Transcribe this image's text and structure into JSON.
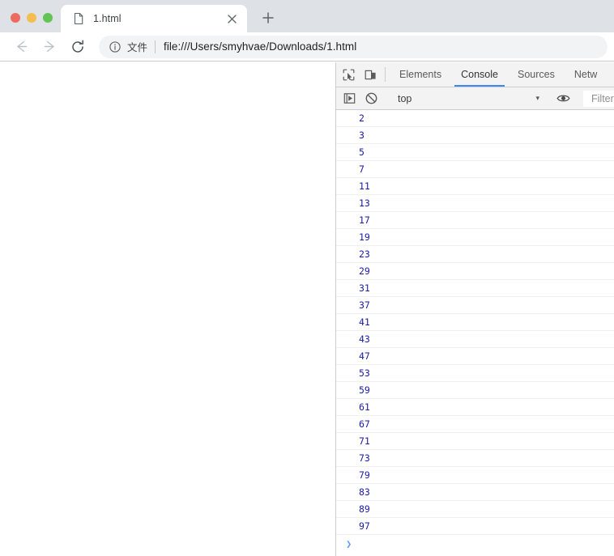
{
  "browser": {
    "window_controls": [
      {
        "name": "close",
        "color": "#ed6a5e"
      },
      {
        "name": "minimize",
        "color": "#f4be4f"
      },
      {
        "name": "maximize",
        "color": "#61c454"
      }
    ],
    "tabs": [
      {
        "title": "1.html",
        "favicon": "document-icon",
        "close_label": "×",
        "active": true
      }
    ],
    "new_tab_label": "+",
    "nav": {
      "back_label": "←",
      "forward_label": "→",
      "reload_label": "⟳"
    },
    "omnibox": {
      "info_icon": "info-circle-icon",
      "scheme_label": "文件",
      "url": "file:///Users/smyhvae/Downloads/1.html"
    }
  },
  "devtools": {
    "toolbar_icons": [
      {
        "name": "inspect-element-icon"
      },
      {
        "name": "device-toolbar-icon"
      }
    ],
    "tabs": [
      {
        "label": "Elements",
        "active": false
      },
      {
        "label": "Console",
        "active": true
      },
      {
        "label": "Sources",
        "active": false
      },
      {
        "label": "Netw",
        "active": false
      }
    ],
    "active_tab_accent": "#4285f4",
    "filterbar": {
      "execute_icon": "execute-snippet-icon",
      "clear_icon": "clear-console-icon",
      "context_value": "top",
      "context_caret": "▾",
      "eye_icon": "live-expression-icon",
      "filter_placeholder": "Filter"
    },
    "console": {
      "text_color": "#1a1aa6",
      "prompt_caret": "❯",
      "messages": [
        "2",
        "3",
        "5",
        "7",
        "11",
        "13",
        "17",
        "19",
        "23",
        "29",
        "31",
        "37",
        "41",
        "43",
        "47",
        "53",
        "59",
        "61",
        "67",
        "71",
        "73",
        "79",
        "83",
        "89",
        "97"
      ]
    }
  }
}
